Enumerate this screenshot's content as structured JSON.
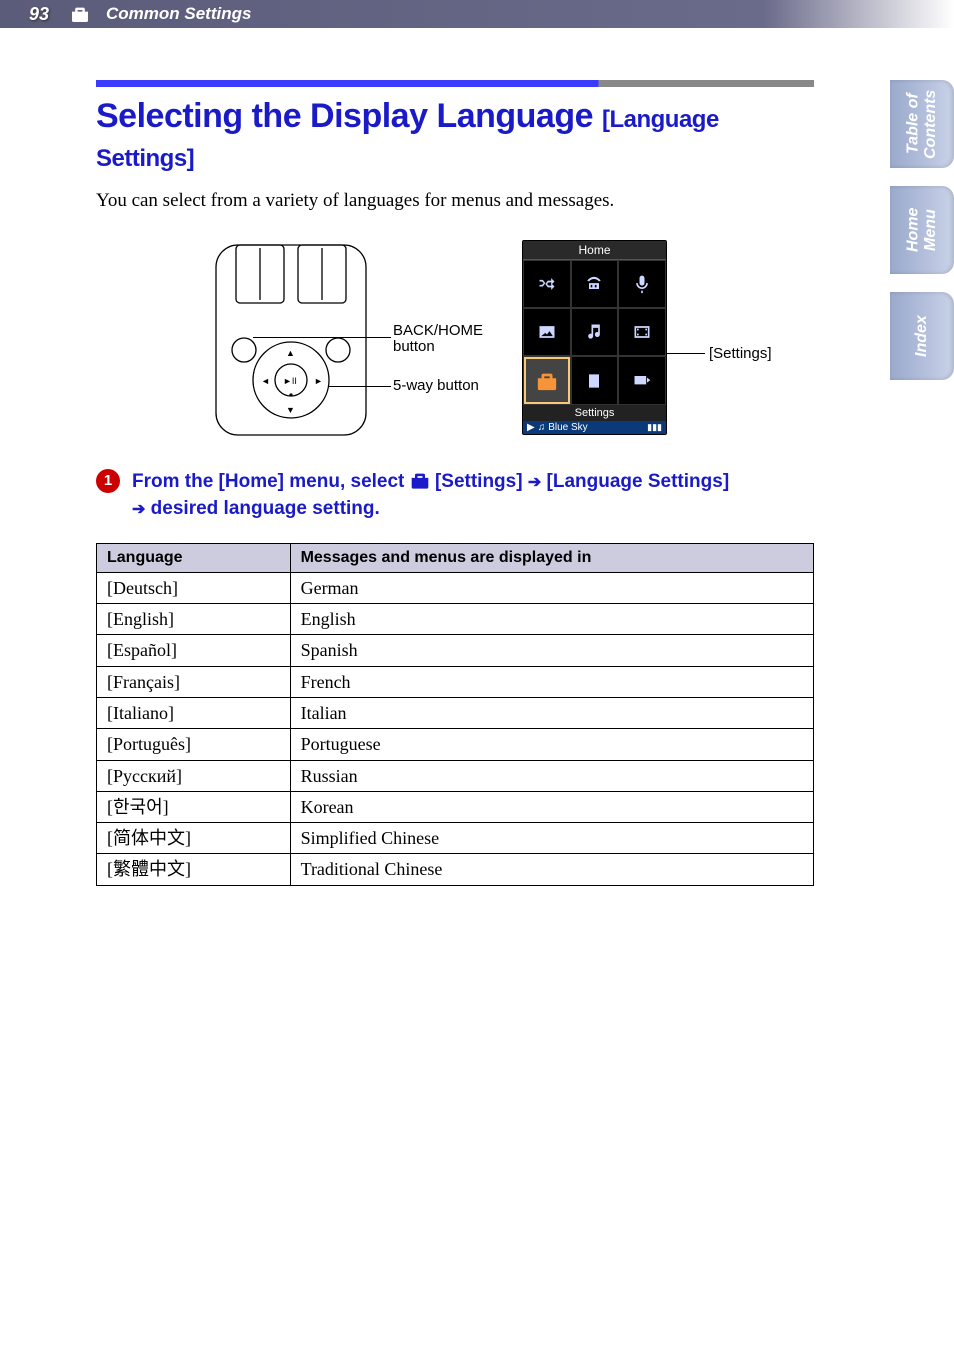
{
  "header": {
    "page_number": "93",
    "section_title": "Common Settings"
  },
  "side_tabs": [
    {
      "label": "Table of\nContents"
    },
    {
      "label": "Home\nMenu"
    },
    {
      "label": "Index"
    }
  ],
  "title": {
    "main": "Selecting the Display Language ",
    "sub": "[Language Settings]"
  },
  "lead": "You can select from a variety of languages for menus and messages.",
  "diagram": {
    "back_home_label": "BACK/HOME button",
    "fiveway_label": "5-way button",
    "screen_title": "Home",
    "screen_footer": "Settings",
    "nowplaying": "Blue Sky",
    "settings_callout": "[Settings]"
  },
  "step": {
    "number": "1",
    "parts": {
      "a": "From the [Home] menu, select ",
      "b": " [Settings] ",
      "c": " [Language Settings] ",
      "d": " desired language setting."
    }
  },
  "table": {
    "headers": {
      "col1": "Language",
      "col2": "Messages and menus are displayed in"
    },
    "rows": [
      {
        "lang": "[Deutsch]",
        "desc": "German"
      },
      {
        "lang": "[English]",
        "desc": "English"
      },
      {
        "lang": "[Español]",
        "desc": "Spanish"
      },
      {
        "lang": "[Français]",
        "desc": "French"
      },
      {
        "lang": "[Italiano]",
        "desc": "Italian"
      },
      {
        "lang": "[Português]",
        "desc": "Portuguese"
      },
      {
        "lang": "[Русский]",
        "desc": "Russian"
      },
      {
        "lang": "[한국어]",
        "desc": "Korean"
      },
      {
        "lang": "[简体中文]",
        "desc": "Simplified Chinese"
      },
      {
        "lang": "[繁體中文]",
        "desc": "Traditional Chinese"
      }
    ]
  }
}
